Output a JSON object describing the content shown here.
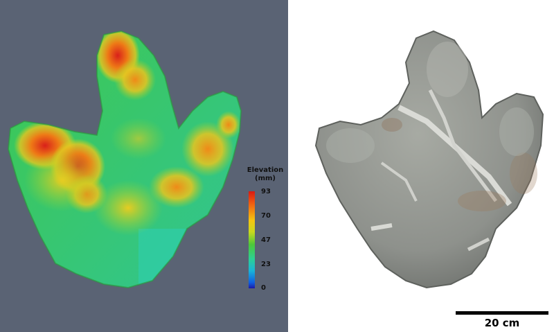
{
  "legend": {
    "title_line1": "Elevation",
    "title_line2": "(mm)",
    "ticks": [
      "93",
      "70",
      "47",
      "23",
      "0"
    ]
  },
  "scale_bar": {
    "label": "20 cm"
  },
  "colors": {
    "left_background": "#5a6374",
    "right_background": "#ffffff",
    "scale_bar": "#000000"
  }
}
